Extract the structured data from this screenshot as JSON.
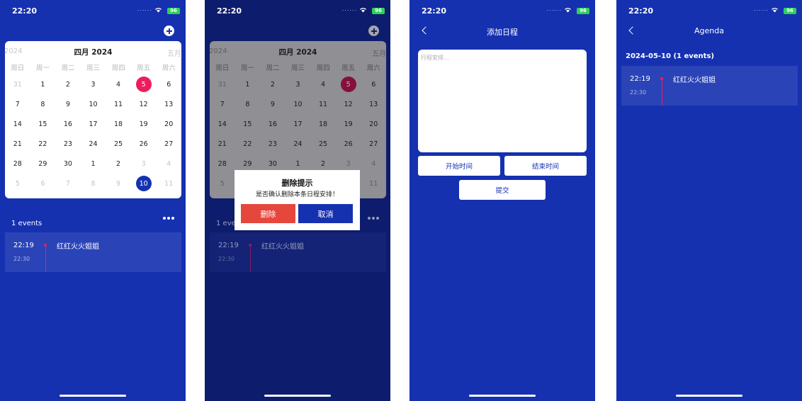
{
  "status": {
    "time": "22:20",
    "battery": "96",
    "dots": "......"
  },
  "calendar": {
    "prev_month": "2024",
    "title": "四月 2024",
    "next_month": "五月",
    "weekdays": [
      "周日",
      "周一",
      "周二",
      "周三",
      "周四",
      "周五",
      "周六"
    ],
    "days": [
      "31",
      "1",
      "2",
      "3",
      "4",
      "5",
      "6",
      "7",
      "8",
      "9",
      "10",
      "11",
      "12",
      "13",
      "14",
      "15",
      "16",
      "17",
      "18",
      "19",
      "20",
      "21",
      "22",
      "23",
      "24",
      "25",
      "26",
      "27",
      "28",
      "29",
      "30",
      "1",
      "2",
      "3",
      "4",
      "5",
      "6",
      "7",
      "8",
      "9",
      "10",
      "11"
    ],
    "today": "5",
    "selected": "10"
  },
  "events_count": "1 events",
  "event": {
    "start": "22:19",
    "end": "22:30",
    "title": "红红火火姐姐"
  },
  "dialog": {
    "title": "删除提示",
    "message": "是否确认删除本条日程安排！",
    "delete_label": "删除",
    "cancel_label": "取消"
  },
  "add_page": {
    "title": "添加日程",
    "placeholder": "行程安排...",
    "start_label": "开始时间",
    "end_label": "结束时间",
    "submit_label": "提交"
  },
  "agenda_page": {
    "title": "Agenda",
    "date_header": "2024-05-10 (1 events)"
  },
  "colors": {
    "background": "#1531b0",
    "today": "#ee1c5f",
    "selected": "#1531b0",
    "delete": "#e5473d",
    "card": "#2a44b8"
  }
}
